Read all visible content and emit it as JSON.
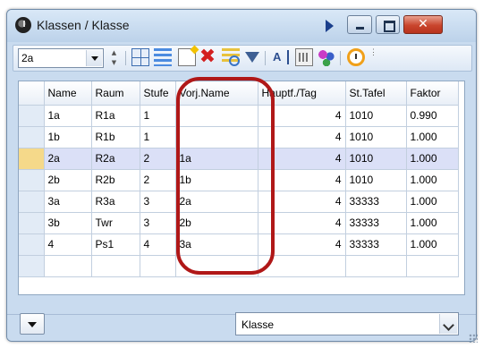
{
  "window": {
    "title": "Klassen / Klasse"
  },
  "toolbar": {
    "class_selector_value": "2a",
    "spin_up": "▲",
    "spin_down": "▼",
    "more": "⋮"
  },
  "table": {
    "columns": [
      "Name",
      "Raum",
      "Stufe",
      "Vorj.Name",
      "Hauptf./Tag",
      "St.Tafel",
      "Faktor"
    ],
    "rows": [
      {
        "name": "1a",
        "raum": "R1a",
        "stufe": "1",
        "vorj": "",
        "hauptf": "4",
        "tafel": "1010",
        "faktor": "0.990"
      },
      {
        "name": "1b",
        "raum": "R1b",
        "stufe": "1",
        "vorj": "",
        "hauptf": "4",
        "tafel": "1010",
        "faktor": "1.000"
      },
      {
        "name": "2a",
        "raum": "R2a",
        "stufe": "2",
        "vorj": "1a",
        "hauptf": "4",
        "tafel": "1010",
        "faktor": "1.000"
      },
      {
        "name": "2b",
        "raum": "R2b",
        "stufe": "2",
        "vorj": "1b",
        "hauptf": "4",
        "tafel": "1010",
        "faktor": "1.000"
      },
      {
        "name": "3a",
        "raum": "R3a",
        "stufe": "3",
        "vorj": "2a",
        "hauptf": "4",
        "tafel": "33333",
        "faktor": "1.000"
      },
      {
        "name": "3b",
        "raum": "Twr",
        "stufe": "3",
        "vorj": "2b",
        "hauptf": "4",
        "tafel": "33333",
        "faktor": "1.000"
      },
      {
        "name": "4",
        "raum": "Ps1",
        "stufe": "4",
        "vorj": "3a",
        "hauptf": "4",
        "tafel": "33333",
        "faktor": "1.000"
      }
    ],
    "current_row_index": 2
  },
  "footer": {
    "view_selector_value": "Klasse"
  },
  "colors": {
    "highlight_ring": "#b01818",
    "current_row": "#dbe0f7",
    "current_row_indicator": "#f5d98a",
    "window_frame": "#c9dbef"
  },
  "icons": [
    "app-icon",
    "play-icon",
    "minimize-icon",
    "maximize-icon",
    "close-icon",
    "grid-view-icon",
    "list-view-icon",
    "new-record-icon",
    "delete-icon",
    "edit-fields-icon",
    "filter-icon",
    "sort-icon",
    "keys-icon",
    "people-icon",
    "clock-icon",
    "more-icon",
    "menu-arrow-icon",
    "resize-grip-icon"
  ]
}
